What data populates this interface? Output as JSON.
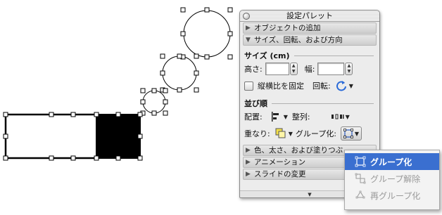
{
  "palette": {
    "title": "設定パレット",
    "sections": {
      "add_object": "オブジェクトの追加",
      "size_rotate": "サイズ、回転、および方向",
      "color_line": "色、太さ、および塗りつぶ",
      "animation": "アニメーション",
      "slide_change": "スライドの変更"
    },
    "size_group": {
      "title": "サイズ (cm)",
      "height_label": "高さ:",
      "height_value": "",
      "width_label": "幅:",
      "width_value": "",
      "lock_ratio_label": "縦横比を固定",
      "rotate_label": "回転:"
    },
    "order_group": {
      "title": "並び順",
      "arrange_label": "配置:",
      "align_label": "整列:",
      "overlap_label": "重なり:",
      "group_label": "グループ化:"
    }
  },
  "popup_menu": {
    "items": [
      {
        "label": "グループ化",
        "selected": true,
        "icon": "group-icon"
      },
      {
        "label": "グループ解除",
        "selected": false,
        "icon": "ungroup-icon"
      },
      {
        "label": "再グループ化",
        "selected": false,
        "icon": "regroup-icon"
      }
    ]
  },
  "colors": {
    "menu_highlight": "#3a6fd0",
    "selected_fill": "#000000"
  }
}
